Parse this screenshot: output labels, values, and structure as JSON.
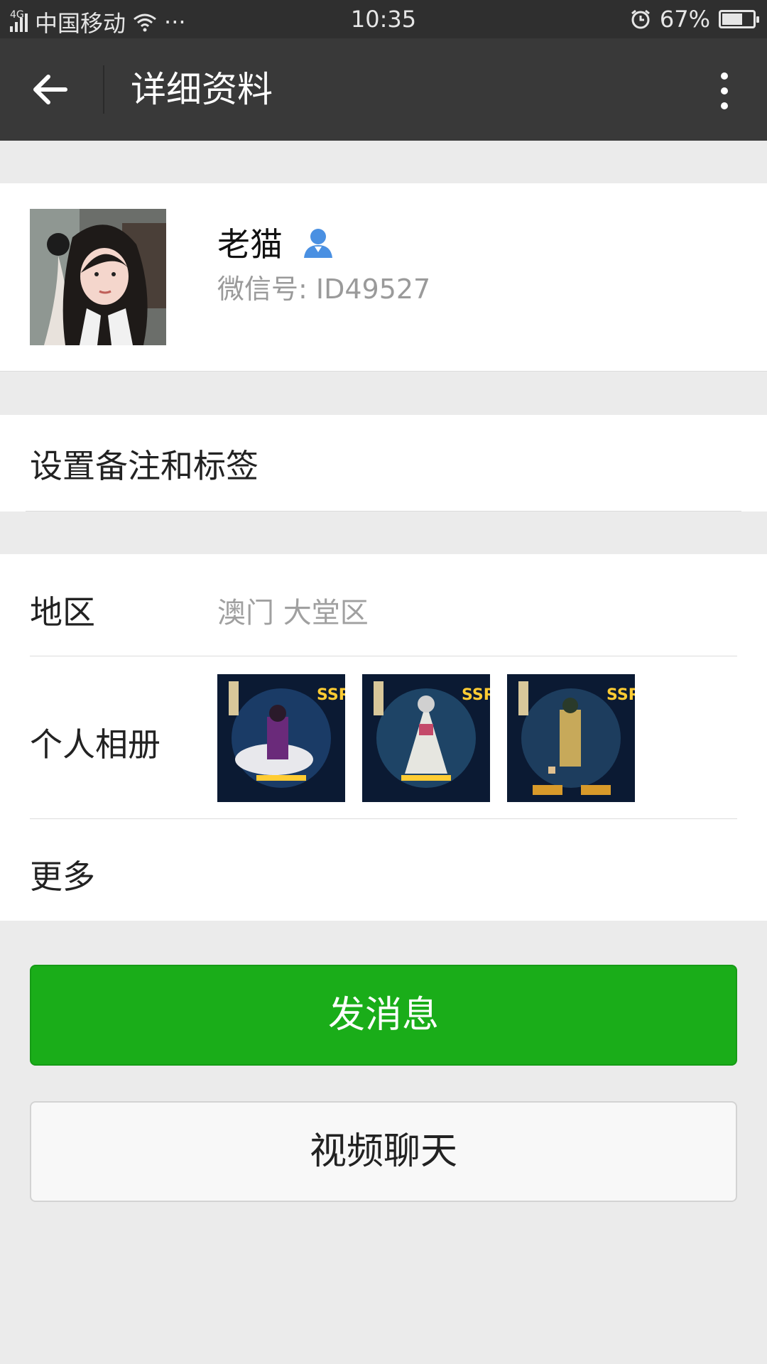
{
  "status_bar": {
    "network": "4G",
    "carrier": "中国移动",
    "dots": "···",
    "time": "10:35",
    "battery_text": "67%",
    "battery_level": 0.67,
    "icons": [
      "signal-icon",
      "wifi-icon",
      "alarm-icon",
      "battery-icon"
    ]
  },
  "nav": {
    "back_icon": "arrow-left-icon",
    "title": "详细资料",
    "more_icon": "more-vertical-icon"
  },
  "profile": {
    "name": "老猫",
    "contact_icon": "contact-person-icon",
    "wechat_id": "微信号: ID49527"
  },
  "remark": {
    "label": "设置备注和标签"
  },
  "info": {
    "region_label": "地区",
    "region_value": "澳门  大堂区",
    "album_label": "个人相册",
    "album_count": 3,
    "more_label": "更多"
  },
  "buttons": {
    "send_message": "发消息",
    "video_call": "视频聊天"
  },
  "colors": {
    "status_bar_bg": "#2f2f2f",
    "nav_bg": "#393939",
    "page_bg": "#ebebeb",
    "primary_green": "#1aad19",
    "contact_icon_blue": "#4a90e2"
  }
}
